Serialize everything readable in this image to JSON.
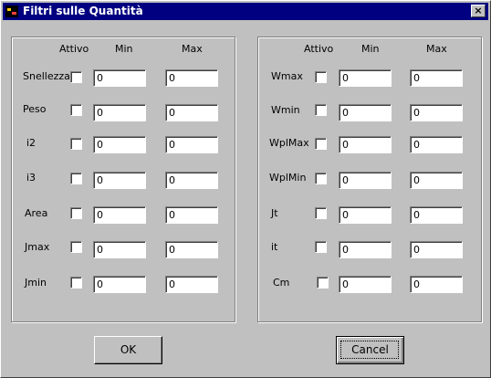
{
  "window": {
    "title": "Filtri sulle Quantità",
    "close_label": "×"
  },
  "columns": {
    "active": "Attivo",
    "min": "Min",
    "max": "Max"
  },
  "left_rows": [
    {
      "label": "Snellezza",
      "min": "0",
      "max": "0"
    },
    {
      "label": "Peso",
      "min": "0",
      "max": "0"
    },
    {
      "label": "i2",
      "min": "0",
      "max": "0"
    },
    {
      "label": "i3",
      "min": "0",
      "max": "0"
    },
    {
      "label": "Area",
      "min": "0",
      "max": "0"
    },
    {
      "label": "Jmax",
      "min": "0",
      "max": "0"
    },
    {
      "label": "Jmin",
      "min": "0",
      "max": "0"
    }
  ],
  "right_rows": [
    {
      "label": "Wmax",
      "min": "0",
      "max": "0"
    },
    {
      "label": "Wmin",
      "min": "0",
      "max": "0"
    },
    {
      "label": "WplMax",
      "min": "0",
      "max": "0"
    },
    {
      "label": "WplMin",
      "min": "0",
      "max": "0"
    },
    {
      "label": "Jt",
      "min": "0",
      "max": "0"
    },
    {
      "label": "it",
      "min": "0",
      "max": "0"
    },
    {
      "label": "Cm",
      "min": "0",
      "max": "0"
    }
  ],
  "buttons": {
    "ok": "OK",
    "cancel": "Cancel"
  }
}
